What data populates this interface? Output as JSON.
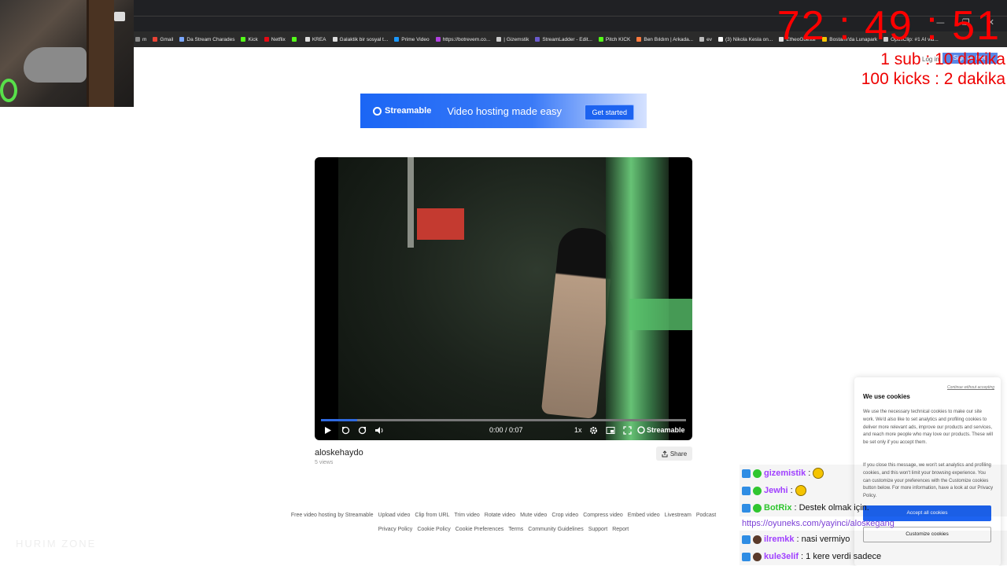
{
  "window": {
    "controls": [
      "—",
      "❐",
      "✕"
    ]
  },
  "bookmarks": [
    {
      "label": "m",
      "color": "#888"
    },
    {
      "label": "Gmail",
      "color": "#ea4335"
    },
    {
      "label": "Da Stream Charades",
      "color": "#7aa7ff"
    },
    {
      "label": "Kick",
      "color": "#53fc18"
    },
    {
      "label": "Netflix",
      "color": "#e50914"
    },
    {
      "label": "",
      "color": "#53fc18"
    },
    {
      "label": "KREA",
      "color": "#ddd"
    },
    {
      "label": "Galaktik bir sosyal t...",
      "color": "#ddd"
    },
    {
      "label": "Prime Video",
      "color": "#1a98ff"
    },
    {
      "label": "https://botrevem.co...",
      "color": "#b040e0"
    },
    {
      "label": "| Gizemstik",
      "color": "#ccc"
    },
    {
      "label": "StreamLadder - Edit...",
      "color": "#6a5acd"
    },
    {
      "label": "Pitch KICK",
      "color": "#53fc18"
    },
    {
      "label": "Ben Bıldım | Arkada...",
      "color": "#ff7a3d"
    },
    {
      "label": "ev",
      "color": "#bbb"
    },
    {
      "label": "(3) Nikola Kesla on...",
      "color": "#fff"
    },
    {
      "label": "EtheoGuessr",
      "color": "#ddd"
    },
    {
      "label": "Bostanlı'da Lunapark",
      "color": "#f5c400"
    },
    {
      "label": "OpusClip: #1 AI vid...",
      "color": "#ccc"
    }
  ],
  "overlay": {
    "timer": "72 : 49 : 51",
    "goal_sub": "1 sub : 10 dakika",
    "goal_kicks": "100 kicks : 2 dakika",
    "login": "Log in",
    "signup": "Sign up free"
  },
  "banner": {
    "brand": "Streamable",
    "tagline": "Video hosting made easy",
    "cta": "Get started"
  },
  "player": {
    "time": "0:00 / 0:07",
    "speed": "1x",
    "brand": "Streamable",
    "progress": 0.1
  },
  "video": {
    "title": "aloskehaydo",
    "views": "5 views",
    "share": "Share"
  },
  "footer": {
    "row1": [
      "Free video hosting by Streamable",
      "Upload video",
      "Clip from URL",
      "Trim video",
      "Rotate video",
      "Mute video",
      "Crop video",
      "Compress video",
      "Embed video",
      "Livestream",
      "Podcast"
    ],
    "row2": [
      "Privacy Policy",
      "Cookie Policy",
      "Cookie Preferences",
      "Terms",
      "Community Guidelines",
      "Support",
      "Report"
    ]
  },
  "cookie": {
    "continue": "Continue without accepting",
    "title": "We use cookies",
    "p1": "We use the necessary technical cookies to make our site work. We'd also like to set analytics and profiling cookies to deliver more relevant ads, improve our products and services, and reach more people who may love our products. These will be set only if you accept them.",
    "p2": "If you close this message, we won't set analytics and profiling cookies, and this won't limit your browsing experience. You can customize your preferences with the Customize cookies button below. For more information, have a look at our Privacy Policy.",
    "accept": "Accept all cookies",
    "customize": "Customize cookies"
  },
  "chat": [
    {
      "user": "gizemistik",
      "color": "#a040ff",
      "text": ":",
      "emoji": true
    },
    {
      "user": "Jewhi",
      "color": "#a040ff",
      "text": ":",
      "emoji": true
    },
    {
      "user": "BotRix",
      "color": "#2fc62f",
      "text": ": Destek olmak için.",
      "emoji": false,
      "link": "https://oyuneks.com/yayinci/aloskegang"
    },
    {
      "user": "ilremkk",
      "color": "#a040ff",
      "text": ": nasi vermiyo",
      "emoji": false
    },
    {
      "user": "kule3elif",
      "color": "#a040ff",
      "text": ": 1 kere verdi sadece",
      "emoji": false
    }
  ],
  "faded_text": "HURIM ZONE"
}
